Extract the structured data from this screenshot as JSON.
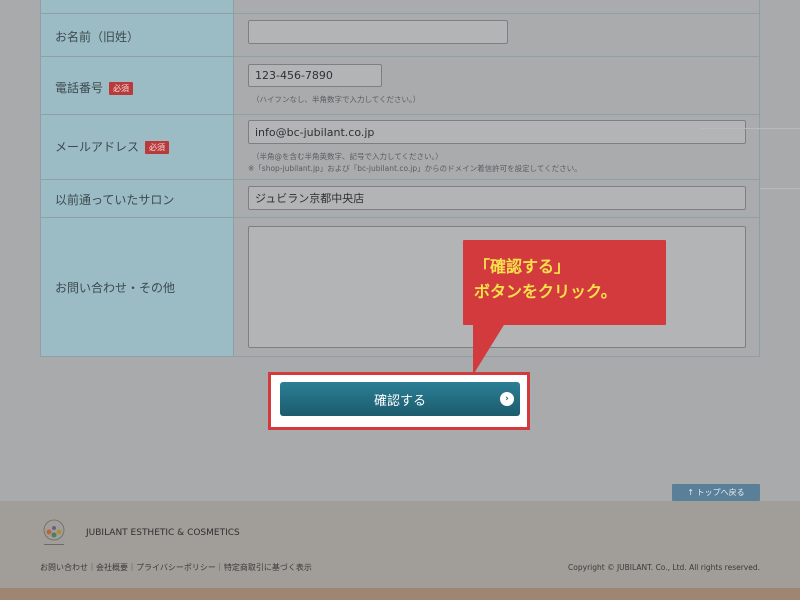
{
  "form": {
    "name_old": {
      "label": "お名前（旧姓）",
      "value": ""
    },
    "phone": {
      "label": "電話番号",
      "required": "必須",
      "value": "123-456-7890",
      "hint": "（ハイフンなし、半角数字で入力してください。）"
    },
    "email": {
      "label": "メールアドレス",
      "required": "必須",
      "value": "info@bc-jubilant.co.jp",
      "hint1": "（半角@を含む半角英数字、記号で入力してください。）",
      "hint2": "※「shop-jubilant.jp」および「bc-jubilant.co.jp」からのドメイン着信許可を設定してください。"
    },
    "salon": {
      "label": "以前通っていたサロン",
      "value": "ジュビラン京都中央店"
    },
    "inquiry": {
      "label": "お問い合わせ・その他",
      "value": ""
    }
  },
  "callout": {
    "line1": "「確認する」",
    "line2": "ボタンをクリック。"
  },
  "confirm_button": {
    "label": "確認する",
    "arrow": "›"
  },
  "top_button": {
    "label": "↑ トップへ戻る"
  },
  "footer": {
    "logo_text": "JUBILANT ESTHETIC & COSMETICS",
    "links": "お問い合わせ｜会社概要｜プライバシーポリシー｜特定商取引に基づく表示",
    "copyright": "Copyright © JUBILANT. Co., Ltd. All rights reserved."
  }
}
